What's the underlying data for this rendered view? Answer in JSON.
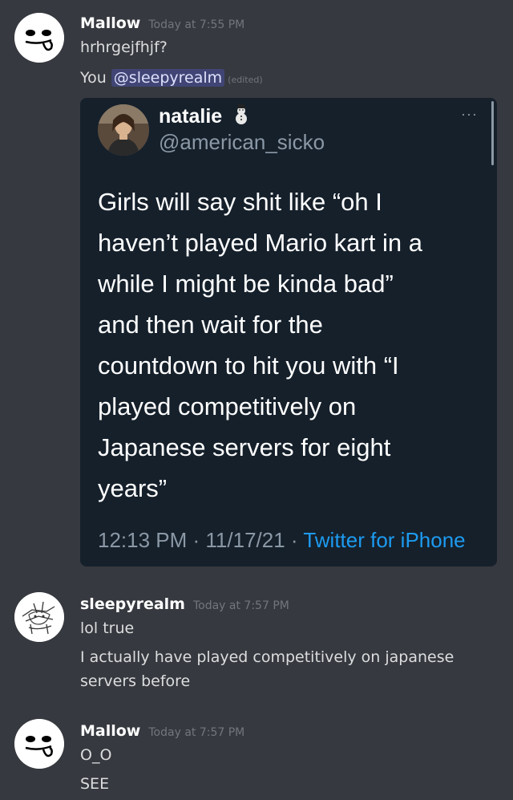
{
  "messages": [
    {
      "username": "Mallow",
      "timestamp": "Today at 7:55 PM",
      "lines": [
        "hrhrgejfhjf?"
      ],
      "reply_prefix": "You",
      "mention": "@sleepyrealm",
      "edited": "(edited)"
    },
    {
      "username": "sleepyrealm",
      "timestamp": "Today at 7:57 PM",
      "lines": [
        "lol true",
        "I actually have played competitively on japanese",
        "servers before"
      ]
    },
    {
      "username": "Mallow",
      "timestamp": "Today at 7:57 PM",
      "lines": [
        "O_O",
        "SEE"
      ]
    }
  ],
  "tweet": {
    "name": "natalie",
    "handle": "@american_sicko",
    "text_lines": [
      "Girls will say shit like “oh I",
      "haven’t played Mario kart in a",
      "while I might be kinda bad”",
      "and then wait for the",
      "countdown to hit you with “I",
      "played competitively on",
      "Japanese servers for eight",
      "years”"
    ],
    "time": "12:13 PM · 11/17/21 · ",
    "source": "Twitter for iPhone",
    "menu": "···",
    "emoji": "snowman-icon"
  },
  "colors": {
    "background": "#36393f",
    "tweet_bg": "#15202b",
    "link": "#1d9bf0",
    "mention_bg": "#5865f24d"
  }
}
